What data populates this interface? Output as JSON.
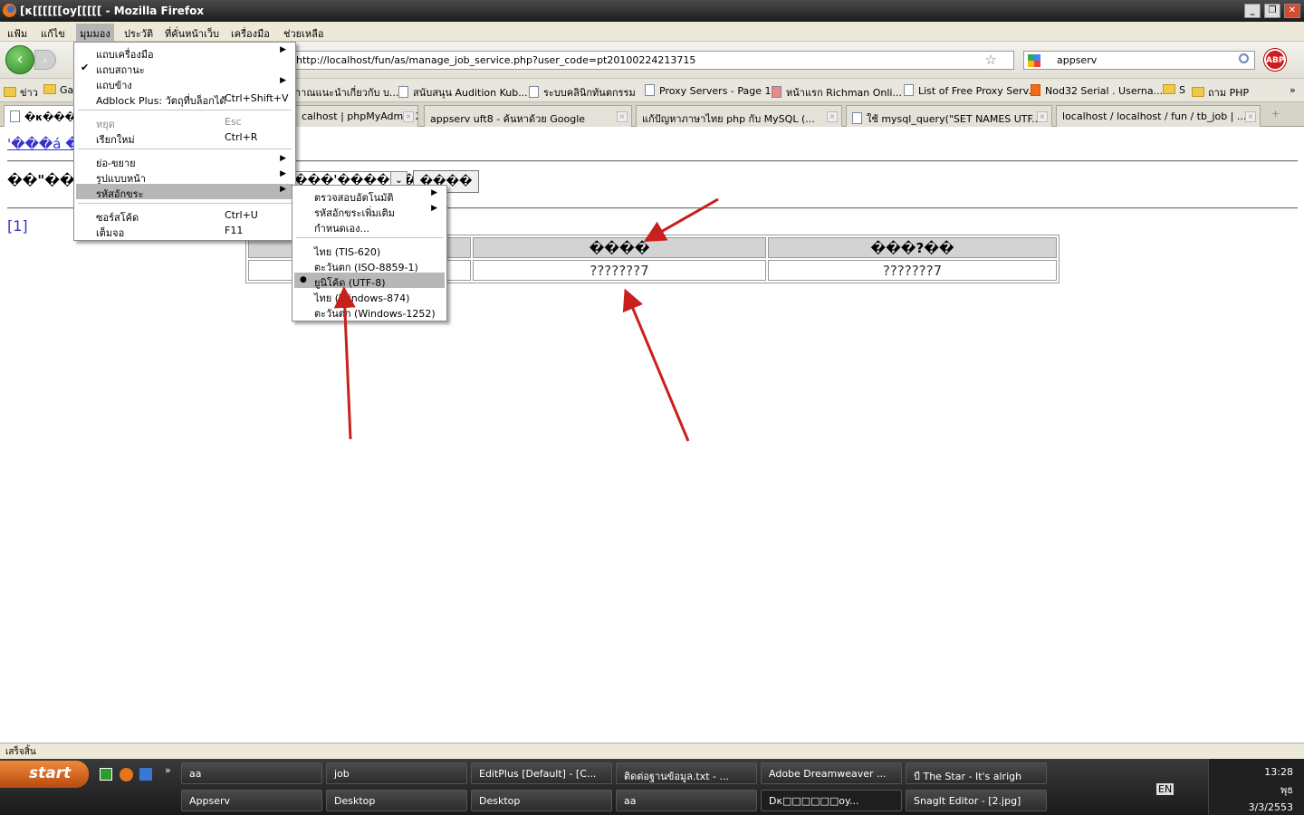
{
  "window": {
    "title": "[κ[[[[[[oy[[[[[ - Mozilla Firefox",
    "min": "_",
    "max": "❐",
    "close": "✕"
  },
  "menubar": [
    "แฟ้ม",
    "แก้ไข",
    "มุมมอง",
    "ประวัติ",
    "ที่คั่นหน้าเว็บ",
    "เครื่องมือ",
    "ช่วยเหลือ"
  ],
  "nav": {
    "back": "‹",
    "forward": "›",
    "url": "http://localhost/fun/as/manage_job_service.php?user_code=pt20100224213715",
    "search": "appserv",
    "abp": "ABP",
    "star": "☆"
  },
  "bookmarks": [
    "ข่าว",
    "Ga",
    "าาณแนะนำเกี่ยวกับ บ...",
    "สนับสนุน Audition Kub...",
    "ระบบคลินิกทันตกรรม",
    "Proxy Servers - Page 1...",
    "หน้าแรก Richman Onli...",
    "List of Free Proxy Serv...",
    "Nod32 Serial . Userna...",
    "S",
    "ถาม PHP",
    "»"
  ],
  "tabs": [
    "�κ���",
    "calhost | phpMyAdmin 2...",
    "appserv uft8 - ค้นหาด้วย Google",
    "แก้ปัญหาภาษาไทย php กับ MySQL (...",
    "ใช้ mysql_query(\"SET NAMES UTF...",
    "localhost / localhost / fun / tb_job | ..."
  ],
  "page": {
    "link": "'���á �",
    "label": "��\"��ä",
    "select_value": "���'������",
    "button": "����",
    "pager": "[1]",
    "table": {
      "headers": [
        "",
        "����",
        "���?��"
      ],
      "row": [
        "",
        "???????7",
        "???????7"
      ]
    }
  },
  "view_menu": [
    {
      "label": "แถบเครื่องมือ",
      "arrow": true
    },
    {
      "label": "แถบสถานะ",
      "check": "✔"
    },
    {
      "label": "แถบข้าง",
      "arrow": true
    },
    {
      "label": "Adblock Plus: วัตถุที่บล็อกได้",
      "shortcut": "Ctrl+Shift+V"
    },
    {
      "sep": true
    },
    {
      "label": "หยุด",
      "shortcut": "Esc",
      "disabled": true
    },
    {
      "label": "เรียกใหม่",
      "shortcut": "Ctrl+R"
    },
    {
      "sep": true
    },
    {
      "label": "ย่อ-ขยาย",
      "arrow": true
    },
    {
      "label": "รูปแบบหน้า",
      "arrow": true
    },
    {
      "label": "รหัสอักขระ",
      "arrow": true,
      "selected": true
    },
    {
      "sep": true
    },
    {
      "label": "ซอร์สโค้ด",
      "shortcut": "Ctrl+U"
    },
    {
      "label": "เต็มจอ",
      "shortcut": "F11"
    }
  ],
  "encoding_menu": [
    {
      "label": "ตรวจสอบอัตโนมัติ",
      "arrow": true
    },
    {
      "label": "รหัสอักขระเพิ่มเติม",
      "arrow": true
    },
    {
      "label": "กำหนดเอง..."
    },
    {
      "sep": true
    },
    {
      "label": "ไทย (TIS-620)"
    },
    {
      "label": "ตะวันตก (ISO-8859-1)"
    },
    {
      "label": "ยูนิโค้ด (UTF-8)",
      "radio": "●",
      "selected": true
    },
    {
      "label": "ไทย (Windows-874)"
    },
    {
      "label": "ตะวันตก (Windows-1252)"
    }
  ],
  "status": "เสร็จสิ้น",
  "taskbar": {
    "start": "start",
    "row1": [
      "aa",
      "job",
      "EditPlus [Default] - [C...",
      "ติดต่อฐานข้อมูล.txt - ...",
      "Adobe Dreamweaver ...",
      "บี The Star - It's alrigh"
    ],
    "row2": [
      "Appserv",
      "Desktop",
      "Desktop",
      "aa",
      "Dκ□□□□□□oy...",
      "SnagIt Editor - [2.jpg]"
    ],
    "lang": "EN",
    "time": "13:28",
    "day": "พุธ",
    "date": "3/3/2553",
    "quick_more": "»"
  },
  "colors": {
    "arrow": "#c8201c",
    "menu_highlight": "#b7b7b7",
    "link": "#3333cc"
  }
}
